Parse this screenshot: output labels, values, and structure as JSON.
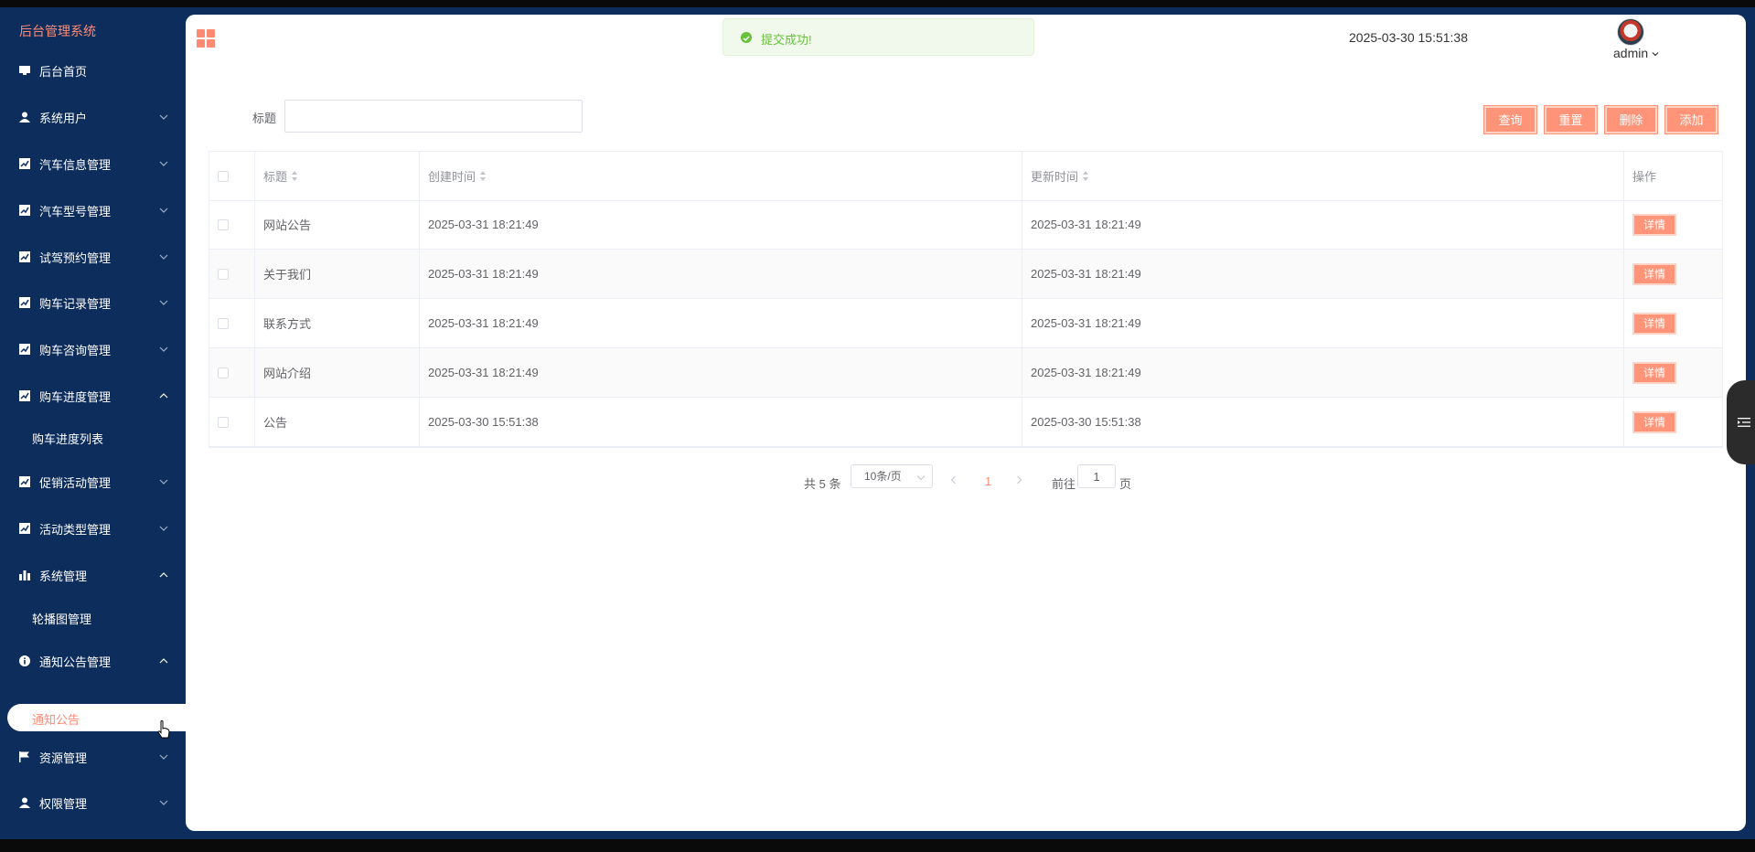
{
  "app": {
    "title": "后台管理系统"
  },
  "sidebar": {
    "items": [
      {
        "label": "后台首页",
        "icon": "monitor-icon"
      },
      {
        "label": "系统用户",
        "icon": "user-icon"
      },
      {
        "label": "汽车信息管理",
        "icon": "chart-icon"
      },
      {
        "label": "汽车型号管理",
        "icon": "chart-icon"
      },
      {
        "label": "试驾预约管理",
        "icon": "chart-icon"
      },
      {
        "label": "购车记录管理",
        "icon": "chart-icon"
      },
      {
        "label": "购车咨询管理",
        "icon": "chart-icon"
      },
      {
        "label": "购车进度管理",
        "icon": "chart-icon"
      },
      {
        "label": "促销活动管理",
        "icon": "chart-icon"
      },
      {
        "label": "活动类型管理",
        "icon": "chart-icon"
      },
      {
        "label": "系统管理",
        "icon": "bar-chart-icon"
      },
      {
        "label": "通知公告管理",
        "icon": "info-icon"
      },
      {
        "label": "资源管理",
        "icon": "flag-icon"
      },
      {
        "label": "权限管理",
        "icon": "user-icon"
      }
    ],
    "sub_progress": "购车进度列表",
    "sub_system": "轮播图管理",
    "sub_notice_active": "通知公告"
  },
  "header": {
    "toast": "提交成功!",
    "datetime": "2025-03-30 15:51:38",
    "username": "admin"
  },
  "search": {
    "label": "标题",
    "value": "",
    "buttons": {
      "query": "查询",
      "reset": "重置",
      "delete": "删除",
      "add": "添加"
    }
  },
  "table": {
    "columns": [
      "标题",
      "创建时间",
      "更新时间",
      "操作"
    ],
    "rows": [
      {
        "title": "网站公告",
        "created": "2025-03-31 18:21:49",
        "updated": "2025-03-31 18:21:49",
        "action": "详情"
      },
      {
        "title": "关于我们",
        "created": "2025-03-31 18:21:49",
        "updated": "2025-03-31 18:21:49",
        "action": "详情"
      },
      {
        "title": "联系方式",
        "created": "2025-03-31 18:21:49",
        "updated": "2025-03-31 18:21:49",
        "action": "详情"
      },
      {
        "title": "网站介绍",
        "created": "2025-03-31 18:21:49",
        "updated": "2025-03-31 18:21:49",
        "action": "详情"
      },
      {
        "title": "公告",
        "created": "2025-03-30 15:51:38",
        "updated": "2025-03-30 15:51:38",
        "action": "详情"
      }
    ]
  },
  "pagination": {
    "total": "共 5 条",
    "page_size": "10条/页",
    "current": "1",
    "goto_label": "前往",
    "goto_value": "1",
    "page_unit": "页"
  },
  "colors": {
    "sidebar_bg": "#0d2d5c",
    "accent": "#ff9478",
    "success": "#67c23a"
  }
}
